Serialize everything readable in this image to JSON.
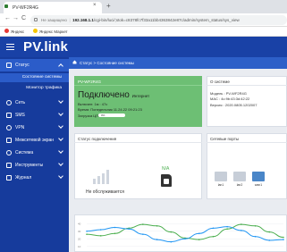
{
  "browser": {
    "tab_title": "PV-WF2R4G",
    "tab_close": "×",
    "new_tab": "+",
    "nav_back": "←",
    "nav_forward": "→",
    "nav_reload": "C",
    "url_warning": "Не защищено",
    "url_host": "192.168.1.1",
    "url_path": "/cgi-bin/luci/;stok=c8378fc7f33a11bb4363842e87c/admin/system_status/sys_view",
    "bookmarks": [
      "Яндекс",
      "Яндекс Маркет"
    ]
  },
  "app": {
    "logo": "PV.link"
  },
  "sidebar": {
    "items": [
      {
        "label": "Статус",
        "expanded": true,
        "icon": "status-icon"
      },
      {
        "label": "Сеть",
        "icon": "network-icon"
      },
      {
        "label": "SMS",
        "icon": "sms-icon"
      },
      {
        "label": "VPN",
        "icon": "vpn-icon"
      },
      {
        "label": "Межсетевой экран",
        "icon": "firewall-icon"
      },
      {
        "label": "Система",
        "icon": "gear-icon"
      },
      {
        "label": "Инструменты",
        "icon": "tools-icon"
      },
      {
        "label": "Журнал",
        "icon": "log-icon"
      }
    ],
    "subitems": [
      {
        "label": "Состояние системы",
        "active": true
      },
      {
        "label": "Монитор трафика",
        "active": false
      }
    ]
  },
  "breadcrumb": "Статус > Состояние системы",
  "status_card": {
    "title": "PV-WF2R4G",
    "status": "Подключено",
    "status_sub": "Интернет",
    "uptime_label": "Включен:",
    "uptime_value": "1м : 47с",
    "time_label": "Время:",
    "time_value": "Понедельник 11.24.22 09:21:23",
    "load_label": "Загрузка ЦП",
    "load_value": "0%",
    "load_fraction": 0.0
  },
  "system_card": {
    "title": "О системе",
    "model_label": "Модель :",
    "model_value": "PV-WF2R4G",
    "mac_label": "MAC :",
    "mac_value": "4c:9b:43:3d:42:22",
    "version_label": "Версия :",
    "version_value": "2020.0805.1202007"
  },
  "connection_card": {
    "title": "Статус подключения",
    "na_label": "N/A",
    "no_service": "Не обслуживается",
    "signal_level": 0
  },
  "ports_card": {
    "title": "Сетевые порты",
    "ports": [
      {
        "label": "lan1",
        "active": false
      },
      {
        "label": "lan2",
        "active": false
      },
      {
        "label": "wan1",
        "active": true
      }
    ]
  },
  "chart_data": {
    "type": "line",
    "yticks": [
      "40",
      "30",
      "20",
      "10"
    ],
    "series": [
      {
        "color": "#4caf50",
        "values": [
          26,
          24,
          27,
          34,
          39,
          37,
          29,
          21,
          19,
          23,
          33,
          39,
          37,
          29,
          22
        ]
      },
      {
        "color": "#2196f3",
        "values": [
          30,
          32,
          35,
          33,
          26,
          19,
          16,
          20,
          27,
          34,
          36,
          31,
          23,
          18,
          19
        ]
      }
    ],
    "ylim": [
      5,
      45
    ]
  },
  "colors": {
    "header": "#1941a6",
    "sidebar": "#163b9c",
    "active": "#2b5cc9",
    "status_ok": "#6dbf74"
  }
}
